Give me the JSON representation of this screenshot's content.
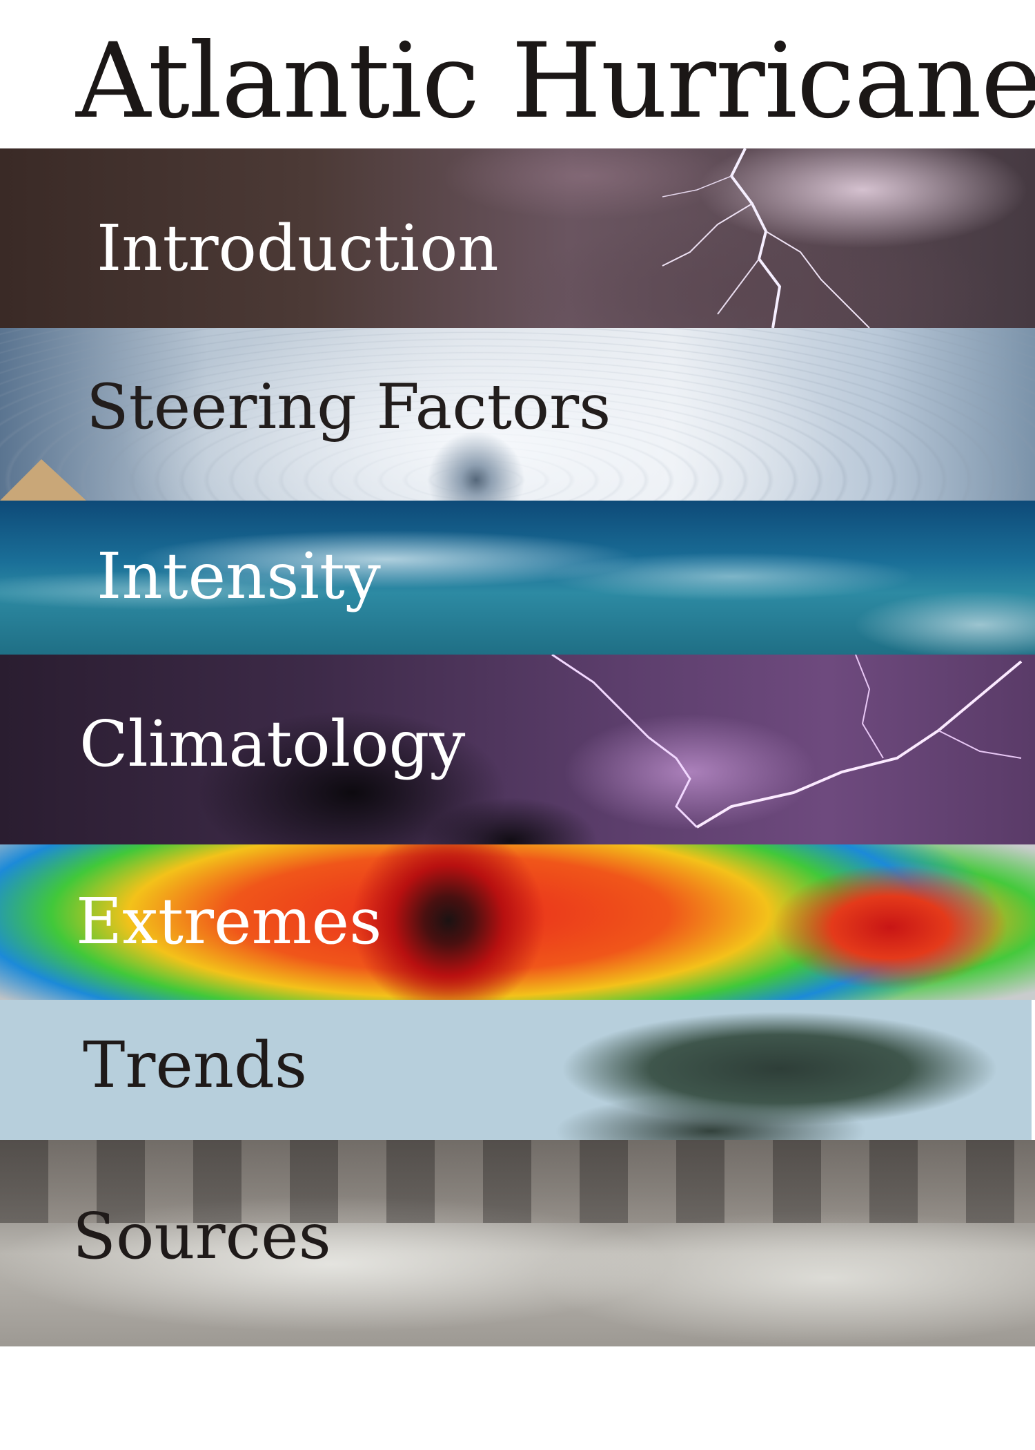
{
  "page": {
    "title": "Atlantic Hurricane"
  },
  "sections": [
    {
      "label": "Introduction",
      "icon": "storm-lightning-image",
      "text_color": "#ffffff"
    },
    {
      "label": "Steering Factors",
      "icon": "hurricane-satellite-image",
      "text_color": "#221d1c"
    },
    {
      "label": "Intensity",
      "icon": "ocean-waves-image",
      "text_color": "#ffffff"
    },
    {
      "label": "Climatology",
      "icon": "purple-lightning-palms-image",
      "text_color": "#ffffff"
    },
    {
      "label": "Extremes",
      "icon": "radar-image",
      "text_color": "#ffffff"
    },
    {
      "label": "Trends",
      "icon": "windblown-palm-image",
      "text_color": "#1f1a19"
    },
    {
      "label": "Sources",
      "icon": "storm-surge-image",
      "text_color": "#1f1a19"
    }
  ]
}
